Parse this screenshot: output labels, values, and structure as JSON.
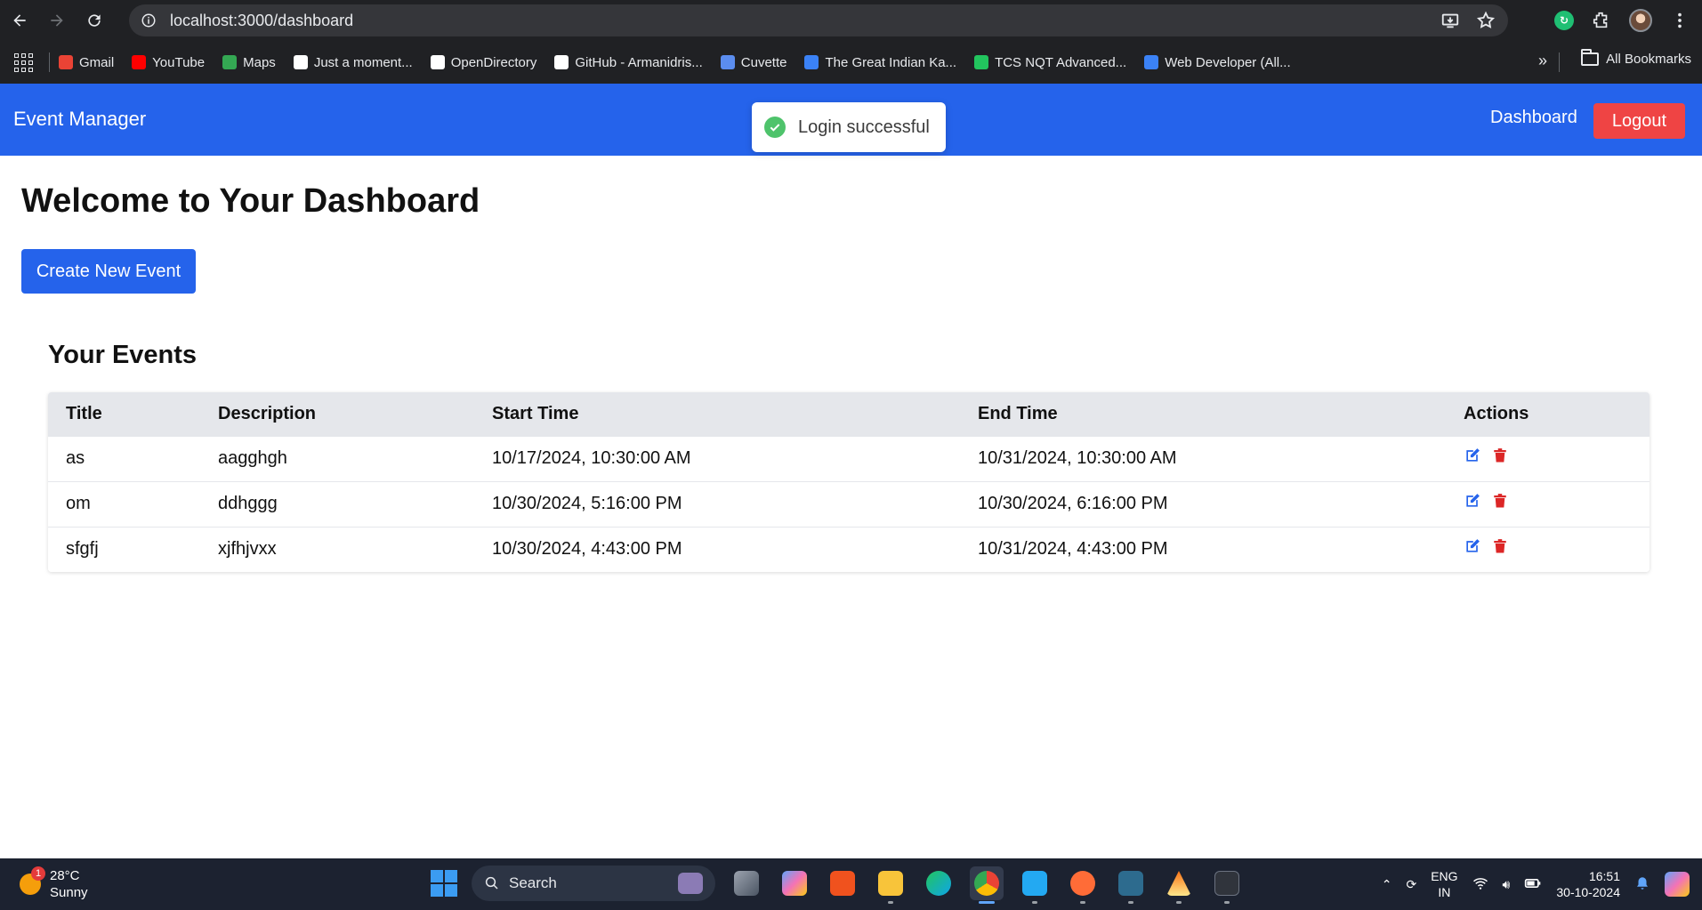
{
  "browser": {
    "url": "localhost:3000/dashboard",
    "bookmarks": [
      {
        "label": "Gmail",
        "icon": "gmail-icon",
        "color": "#ea4335"
      },
      {
        "label": "YouTube",
        "icon": "youtube-icon",
        "color": "#ff0000"
      },
      {
        "label": "Maps",
        "icon": "maps-icon",
        "color": "#34a853"
      },
      {
        "label": "Just a moment...",
        "icon": "page-icon",
        "color": "#ffffff"
      },
      {
        "label": "OpenDirectory",
        "icon": "page-icon",
        "color": "#ffffff"
      },
      {
        "label": "GitHub - Armanidris...",
        "icon": "github-icon",
        "color": "#ffffff"
      },
      {
        "label": "Cuvette",
        "icon": "cuvette-icon",
        "color": "#5b8def"
      },
      {
        "label": "The Great Indian Ka...",
        "icon": "fz-icon",
        "color": "#3b82f6"
      },
      {
        "label": "TCS NQT Advanced...",
        "icon": "tcs-icon",
        "color": "#22c55e"
      },
      {
        "label": "Web Developer (All...",
        "icon": "webdev-icon",
        "color": "#3b82f6"
      }
    ],
    "all_bookmarks": "All Bookmarks"
  },
  "app": {
    "brand": "Event Manager",
    "nav_dashboard": "Dashboard",
    "logout": "Logout",
    "toast": "Login successful",
    "page_title": "Welcome to Your Dashboard",
    "create_button": "Create New Event",
    "section_title": "Your Events",
    "table": {
      "headers": [
        "Title",
        "Description",
        "Start Time",
        "End Time",
        "Actions"
      ],
      "rows": [
        {
          "title": "as",
          "description": "aagghgh",
          "start": "10/17/2024, 10:30:00 AM",
          "end": "10/31/2024, 10:30:00 AM"
        },
        {
          "title": "om",
          "description": "ddhggg",
          "start": "10/30/2024, 5:16:00 PM",
          "end": "10/30/2024, 6:16:00 PM"
        },
        {
          "title": "sfgfj",
          "description": "xjfhjvxx",
          "start": "10/30/2024, 4:43:00 PM",
          "end": "10/31/2024, 4:43:00 PM"
        }
      ]
    },
    "colors": {
      "primary": "#2563eb",
      "danger": "#ef4444",
      "toast_success": "#4ec36b"
    }
  },
  "taskbar": {
    "weather_temp": "28°C",
    "weather_desc": "Sunny",
    "weather_badge": "1",
    "search_label": "Search",
    "lang_top": "ENG",
    "lang_bottom": "IN",
    "time": "16:51",
    "date": "30-10-2024"
  }
}
